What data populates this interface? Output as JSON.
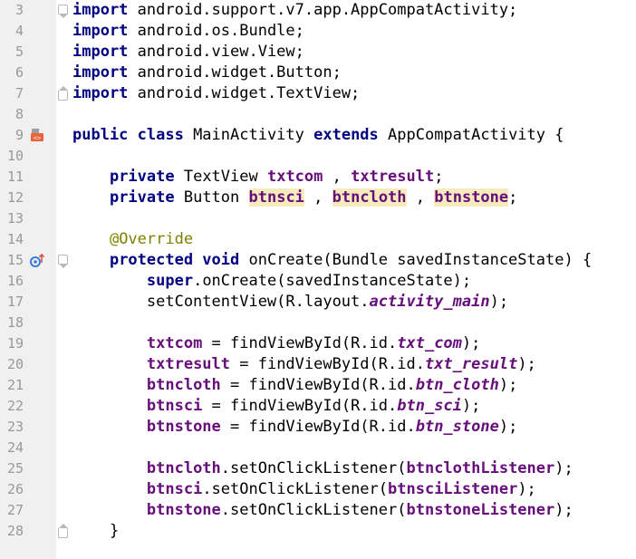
{
  "editor": {
    "lines": [
      {
        "n": "3",
        "t": [
          [
            "kw",
            "import"
          ],
          [
            "",
            "android.support.v7.app.AppCompatActivity;"
          ]
        ]
      },
      {
        "n": "4",
        "t": [
          [
            "kw",
            "import"
          ],
          [
            "",
            "android.os.Bundle;"
          ]
        ]
      },
      {
        "n": "5",
        "t": [
          [
            "kw",
            "import"
          ],
          [
            "",
            "android.view.View;"
          ]
        ]
      },
      {
        "n": "6",
        "t": [
          [
            "kw",
            "import"
          ],
          [
            "",
            "android.widget.Button;"
          ]
        ]
      },
      {
        "n": "7",
        "t": [
          [
            "kw",
            "import"
          ],
          [
            "",
            "android.widget.TextView;"
          ]
        ]
      },
      {
        "n": "8",
        "t": []
      },
      {
        "n": "9",
        "t": [
          [
            "kw",
            "public class"
          ],
          [
            "",
            " MainActivity "
          ],
          [
            "kw",
            "extends"
          ],
          [
            "",
            " AppCompatActivity {"
          ]
        ]
      },
      {
        "n": "10",
        "t": []
      },
      {
        "n": "11",
        "t": [
          [
            "",
            "    "
          ],
          [
            "kw",
            "private"
          ],
          [
            "",
            " TextView "
          ],
          [
            "fld",
            "txtcom"
          ],
          [
            "",
            " , "
          ],
          [
            "fld",
            "txtresult"
          ],
          [
            "",
            ";"
          ]
        ]
      },
      {
        "n": "12",
        "t": [
          [
            "",
            "    "
          ],
          [
            "kw",
            "private"
          ],
          [
            "",
            " Button "
          ],
          [
            "fld unused",
            "btnsci"
          ],
          [
            "",
            " , "
          ],
          [
            "fld unused",
            "btncloth"
          ],
          [
            "",
            " , "
          ],
          [
            "fld unused",
            "btnstone"
          ],
          [
            "",
            ";"
          ]
        ]
      },
      {
        "n": "13",
        "t": []
      },
      {
        "n": "14",
        "t": [
          [
            "",
            "    "
          ],
          [
            "ann",
            "@Override"
          ]
        ]
      },
      {
        "n": "15",
        "t": [
          [
            "",
            "    "
          ],
          [
            "kw",
            "protected void"
          ],
          [
            "",
            " onCreate(Bundle savedInstanceState) {"
          ]
        ]
      },
      {
        "n": "16",
        "t": [
          [
            "",
            "        "
          ],
          [
            "kw",
            "super"
          ],
          [
            "",
            ".onCreate(savedInstanceState);"
          ]
        ]
      },
      {
        "n": "17",
        "t": [
          [
            "",
            "        setContentView(R.layout."
          ],
          [
            "ital",
            "activity_main"
          ],
          [
            "",
            ");"
          ]
        ]
      },
      {
        "n": "18",
        "t": []
      },
      {
        "n": "19",
        "t": [
          [
            "",
            "        "
          ],
          [
            "fld",
            "txtcom"
          ],
          [
            "",
            " = findViewById(R.id."
          ],
          [
            "ital",
            "txt_com"
          ],
          [
            "",
            ");"
          ]
        ]
      },
      {
        "n": "20",
        "t": [
          [
            "",
            "        "
          ],
          [
            "fld",
            "txtresult"
          ],
          [
            "",
            " = findViewById(R.id."
          ],
          [
            "ital",
            "txt_result"
          ],
          [
            "",
            ");"
          ]
        ]
      },
      {
        "n": "21",
        "t": [
          [
            "",
            "        "
          ],
          [
            "fld",
            "btncloth"
          ],
          [
            "",
            " = findViewById(R.id."
          ],
          [
            "ital",
            "btn_cloth"
          ],
          [
            "",
            ");"
          ]
        ]
      },
      {
        "n": "22",
        "t": [
          [
            "",
            "        "
          ],
          [
            "fld",
            "btnsci"
          ],
          [
            "",
            " = findViewById(R.id."
          ],
          [
            "ital",
            "btn_sci"
          ],
          [
            "",
            ");"
          ]
        ]
      },
      {
        "n": "23",
        "t": [
          [
            "",
            "        "
          ],
          [
            "fld",
            "btnstone"
          ],
          [
            "",
            " = findViewById(R.id."
          ],
          [
            "ital",
            "btn_stone"
          ],
          [
            "",
            ");"
          ]
        ]
      },
      {
        "n": "24",
        "t": []
      },
      {
        "n": "25",
        "t": [
          [
            "",
            "        "
          ],
          [
            "fld",
            "btncloth"
          ],
          [
            "",
            ".setOnClickListener("
          ],
          [
            "fld",
            "btnclothListener"
          ],
          [
            "",
            ");"
          ]
        ]
      },
      {
        "n": "26",
        "t": [
          [
            "",
            "        "
          ],
          [
            "fld",
            "btnsci"
          ],
          [
            "",
            ".setOnClickListener("
          ],
          [
            "fld",
            "btnsciListener"
          ],
          [
            "",
            ");"
          ]
        ]
      },
      {
        "n": "27",
        "t": [
          [
            "",
            "        "
          ],
          [
            "fld",
            "btnstone"
          ],
          [
            "",
            ".setOnClickListener("
          ],
          [
            "fld",
            "btnstoneListener"
          ],
          [
            "",
            ");"
          ]
        ]
      },
      {
        "n": "28",
        "t": [
          [
            "",
            "    }"
          ]
        ]
      }
    ],
    "fold_markers": {
      "3": "open",
      "7": "close",
      "15": "open",
      "28": "close"
    },
    "gutter_icons": {
      "9": "run-activity-icon",
      "15": "override-method-icon"
    },
    "colors": {
      "keyword": "#000080",
      "field": "#660e7a",
      "annotation": "#808000",
      "unused_highlight": "#f6ebbc",
      "line_number": "#999999",
      "gutter_bg": "#f0f0f0"
    }
  }
}
